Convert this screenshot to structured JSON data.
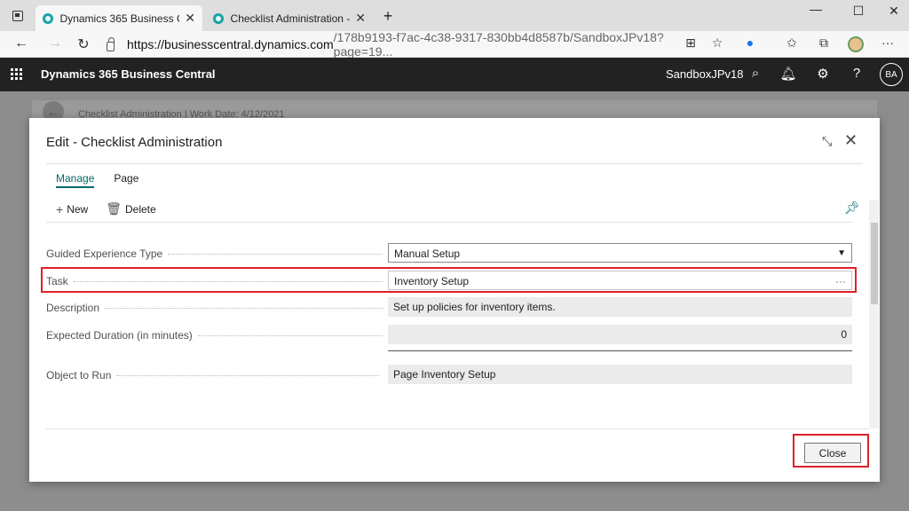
{
  "browser": {
    "tabs": [
      {
        "label": "Dynamics 365 Business Central - ",
        "active": true
      },
      {
        "label": "Checklist Administration - Dyna",
        "active": false
      }
    ],
    "new_tab": "+",
    "url_host": "https://businesscentral.dynamics.com",
    "url_path": "/178b9193-f7ac-4c38-9317-830bb4d8587b/SandboxJPv18?page=19..."
  },
  "app": {
    "title": "Dynamics 365 Business Central",
    "environment": "SandboxJPv18",
    "user_initials": "BA"
  },
  "background": {
    "breadcrumb": "Checklist Administration | Work Date: 4/12/2021"
  },
  "dialog": {
    "title": "Edit - Checklist Administration",
    "action_tabs": [
      "Manage",
      "Page"
    ],
    "toolbar": {
      "new_label": "New",
      "delete_label": "Delete"
    },
    "fields": {
      "guided_type": {
        "label": "Guided Experience Type",
        "value": "Manual Setup"
      },
      "task": {
        "label": "Task",
        "value": "Inventory Setup",
        "lookup": "···"
      },
      "description": {
        "label": "Description",
        "value": "Set up policies for inventory items."
      },
      "duration": {
        "label": "Expected Duration (in minutes)",
        "value": "0"
      },
      "object_to_run": {
        "label": "Object to Run",
        "value": "Page Inventory Setup"
      }
    },
    "close_label": "Close"
  },
  "colors": {
    "accent": "#00696b",
    "highlight": "#e0202a",
    "header": "#222222"
  }
}
